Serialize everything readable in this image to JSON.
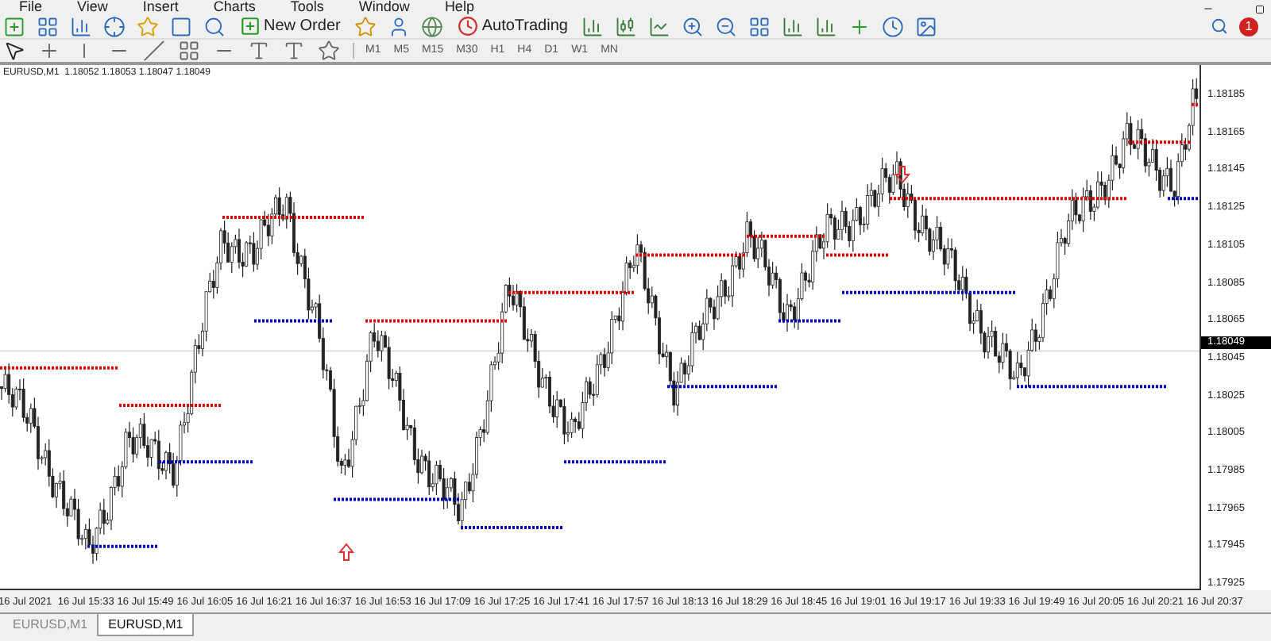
{
  "menu": [
    "File",
    "View",
    "Insert",
    "Charts",
    "Tools",
    "Window",
    "Help"
  ],
  "toolbar": {
    "new_order": "New Order",
    "auto_trading": "AutoTrading",
    "notifications": "1"
  },
  "timeframes": [
    {
      "label": "M1",
      "selected": false
    },
    {
      "label": "M5",
      "selected": false
    },
    {
      "label": "M15",
      "selected": false
    },
    {
      "label": "M30",
      "selected": false
    },
    {
      "label": "H1",
      "selected": false
    },
    {
      "label": "H4",
      "selected": false
    },
    {
      "label": "D1",
      "selected": false
    },
    {
      "label": "W1",
      "selected": false
    },
    {
      "label": "MN",
      "selected": false
    }
  ],
  "chart": {
    "info": "EURUSD,M1  1.18052 1.18053 1.18047 1.18049",
    "current_price": "1.18049",
    "price_labels": [
      "1.18185",
      "1.18165",
      "1.18145",
      "1.18125",
      "1.18105",
      "1.18085",
      "1.18065",
      "1.18045",
      "1.18025",
      "1.18005",
      "1.17985",
      "1.17965",
      "1.17945",
      "1.17925"
    ],
    "time_labels": [
      "16 Jul 2021",
      "16 Jul 15:33",
      "16 Jul 15:49",
      "16 Jul 16:05",
      "16 Jul 16:21",
      "16 Jul 16:37",
      "16 Jul 16:53",
      "16 Jul 17:09",
      "16 Jul 17:25",
      "16 Jul 17:41",
      "16 Jul 17:57",
      "16 Jul 18:13",
      "16 Jul 18:29",
      "16 Jul 18:45",
      "16 Jul 19:01",
      "16 Jul 19:17",
      "16 Jul 19:33",
      "16 Jul 19:49",
      "16 Jul 20:05",
      "16 Jul 20:21",
      "16 Jul 20:37"
    ]
  },
  "tabs": [
    {
      "label": "EURUSD,M1",
      "selected": false
    },
    {
      "label": "EURUSD,M1",
      "selected": true
    }
  ]
}
